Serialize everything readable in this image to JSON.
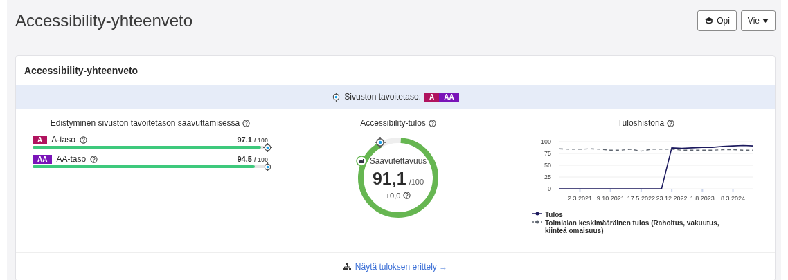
{
  "page": {
    "title": "Accessibility-yhteenveto",
    "buttons": [
      {
        "kind": "learn",
        "label": "Opi"
      },
      {
        "kind": "menu",
        "label": "Vie"
      }
    ]
  },
  "card": {
    "title": "Accessibility-yhteenveto",
    "target": {
      "label": "Sivuston tavoitetaso:",
      "levels": [
        {
          "label": "A",
          "color": "#b0135e"
        },
        {
          "label": "AA",
          "color": "#7a14b8"
        }
      ]
    },
    "progress": {
      "title": "Edistyminen sivuston tavoitetason saavuttamisessa",
      "rows": [
        {
          "badge": "A",
          "color": "#b0135e",
          "label": "A-taso",
          "score": "97.1",
          "max": "/ 100",
          "level": 0.971
        },
        {
          "badge": "AA",
          "color": "#7a14b8",
          "label": "AA-taso",
          "score": "94.5",
          "max": "/ 100",
          "level": 0.945
        }
      ]
    },
    "score": {
      "title": "Accessibility-tulos",
      "label": "Saavutettavuus",
      "value": "91,1",
      "max": "/100",
      "change": "+0,0",
      "level": 0.911
    },
    "history": {
      "title": "Tuloshistoria",
      "chart_data": {
        "type": "line",
        "categories": [
          null,
          null,
          "2.3.2021",
          null,
          null,
          "9.10.2021",
          null,
          null,
          "17.5.2022",
          null,
          null,
          "23.12.2022",
          null,
          null,
          "1.8.2023",
          null,
          null,
          "8.3.2024",
          null,
          null
        ],
        "grid": true,
        "ylim": [
          0,
          100
        ],
        "yticks": [
          0,
          25,
          50,
          75,
          100
        ],
        "series": [
          {
            "name": "Tulos",
            "color": "#1c1a5e",
            "line_style": "solid",
            "values": [
              0,
              0,
              0,
              0,
              0,
              0,
              0,
              0,
              0,
              0,
              0,
              87,
              86,
              87,
              88,
              88,
              90,
              91,
              92,
              91
            ]
          },
          {
            "name": "Toimialan keskimääräinen tulos (Rahoitus, vakuutus, kiinteä omaisuus)",
            "color": "#5f6670",
            "line_style": "dashed",
            "values": [
              85,
              84,
              84,
              85,
              84,
              82,
              82,
              84,
              80,
              84,
              84,
              84,
              82,
              82,
              82,
              82,
              83,
              83,
              82,
              82
            ]
          }
        ]
      }
    },
    "footer_link": "Näytä tuloksen erittely →"
  }
}
